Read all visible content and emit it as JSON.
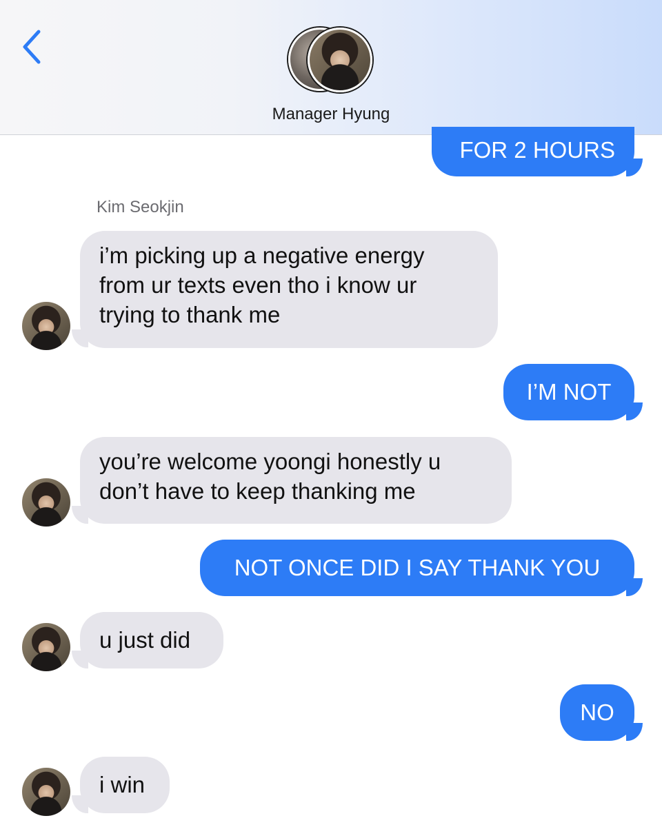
{
  "header": {
    "back_icon": "chevron-left-icon",
    "contact_name": "Manager Hyung",
    "accent_color": "#2d7cf6"
  },
  "sender_name": "Kim Seokjin",
  "messages": [
    {
      "direction": "outgoing",
      "text": "FOR 2 HOURS"
    },
    {
      "direction": "incoming",
      "lines": [
        "i’m picking up a negative energy",
        "from ur texts even tho i know ur",
        "trying to thank me"
      ]
    },
    {
      "direction": "outgoing",
      "text": "I’M NOT"
    },
    {
      "direction": "incoming",
      "lines": [
        "you’re welcome yoongi honestly u",
        "don’t have to keep thanking me"
      ]
    },
    {
      "direction": "outgoing",
      "text": "NOT ONCE DID I SAY THANK YOU"
    },
    {
      "direction": "incoming",
      "lines": [
        "u just did"
      ]
    },
    {
      "direction": "outgoing",
      "text": "NO"
    },
    {
      "direction": "incoming",
      "lines": [
        "i win"
      ]
    }
  ]
}
